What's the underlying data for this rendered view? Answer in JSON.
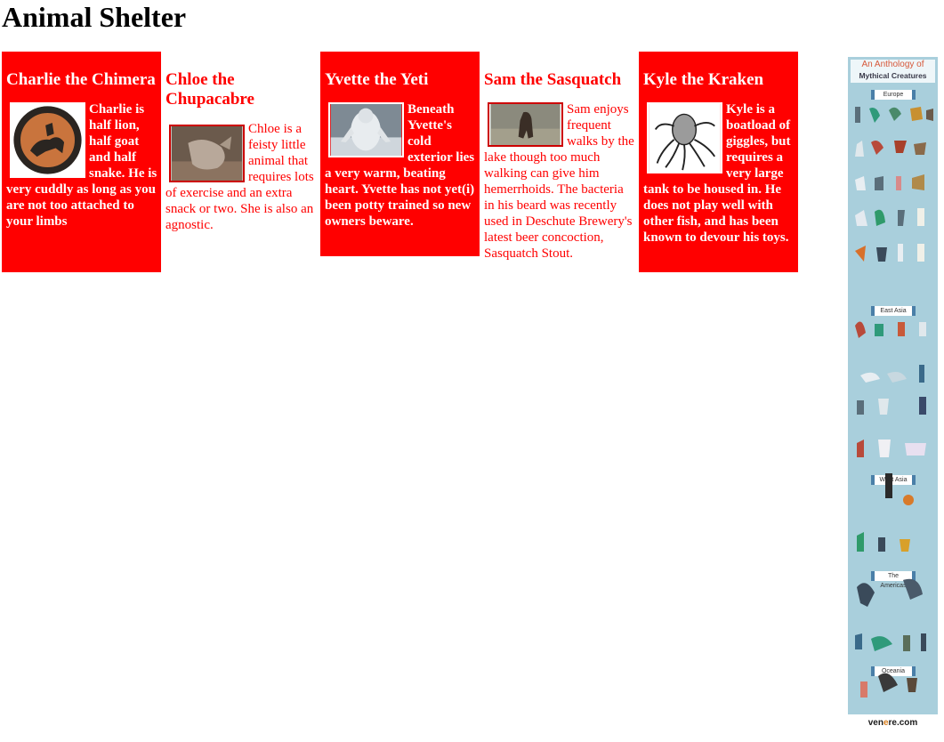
{
  "page": {
    "title": "Animal Shelter"
  },
  "cards": [
    {
      "name": "Charlie the Chimera",
      "description": "Charlie is half lion, half goat and half snake. He is very cuddly as long as you are not too attached to your limbs",
      "image_icon": "chimera-vase-icon"
    },
    {
      "name": "Chloe the Chupacabre",
      "description": "Chloe is a feisty little animal that requires lots of exercise and an extra snack or two. She is also an agnostic.",
      "image_icon": "chupacabra-photo-icon"
    },
    {
      "name": "Yvette the Yeti",
      "description": "Beneath Yvette's cold exterior lies a very warm, beating heart. Yvette has not yet(i) been potty trained so new owners beware.",
      "image_icon": "yeti-photo-icon"
    },
    {
      "name": "Sam the Sasquatch",
      "description": "Sam enjoys frequent walks by the lake though too much walking can give him hemerrhoids. The bacteria in his beard was recently used in Deschute Brewery's latest beer concoction, Sasquatch Stout.",
      "image_icon": "sasquatch-photo-icon"
    },
    {
      "name": "Kyle the Kraken",
      "description": "Kyle is a boatload of giggles, but requires a very large tank to be housed in. He does not play well with other fish, and has been known to devour his toys.",
      "image_icon": "kraken-drawing-icon"
    }
  ],
  "infographic": {
    "title_line1": "An Anthology of",
    "title_line2": "Mythical Creatures",
    "sections": [
      "Europe",
      "East Asia",
      "West Asia",
      "The Americas",
      "Oceania"
    ],
    "footer_prefix": "ven",
    "footer_accent": "e",
    "footer_suffix": "re.com"
  },
  "colors": {
    "card_red": "#ff0000",
    "card_text_red": "#ff0000",
    "infographic_bg": "#a9cfdc"
  }
}
